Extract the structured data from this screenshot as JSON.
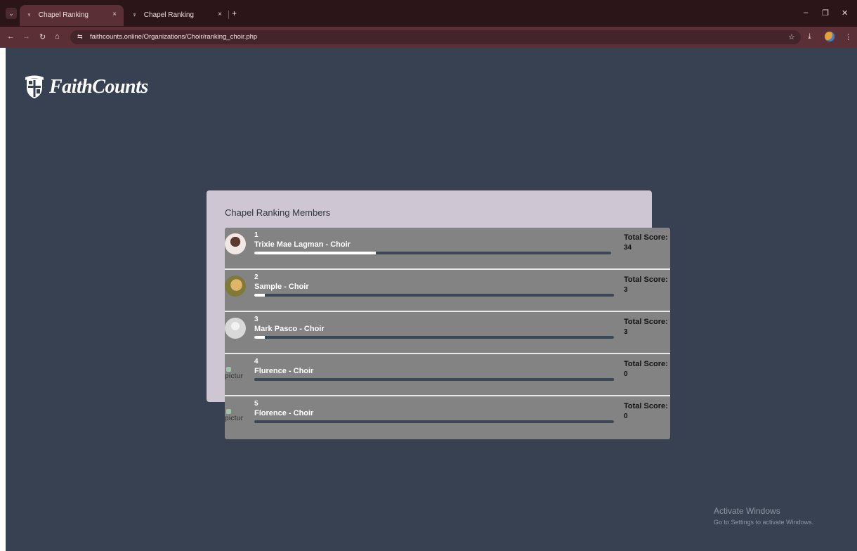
{
  "browser": {
    "tabs": [
      {
        "title": "Chapel Ranking",
        "active": true
      },
      {
        "title": "Chapel Ranking",
        "active": false
      }
    ],
    "new_tab_label": "+",
    "close_glyph": "×",
    "url": "faithcounts.online/Organizations/Choir/ranking_choir.php",
    "controls": {
      "minimize": "–",
      "maximize": "❐",
      "close": "✕"
    },
    "icons": {
      "back": "←",
      "forward": "→",
      "reload": "↻",
      "home": "⌂",
      "site_info": "⇆",
      "bookmark": "☆",
      "download": "⤓",
      "menu": "⋮",
      "tab_menu": "⌄"
    }
  },
  "brand": {
    "name": "FaithCounts"
  },
  "panel": {
    "title": "Chapel Ranking Members"
  },
  "members": [
    {
      "rank": "1",
      "name": "Trixie Mae Lagman - Choir",
      "score_label": "Total Score:",
      "score": "34",
      "progress_pct": 34,
      "avatar": "photo"
    },
    {
      "rank": "2",
      "name": "Sample - Choir",
      "score_label": "Total Score:",
      "score": "3",
      "progress_pct": 3,
      "avatar": "photo"
    },
    {
      "rank": "3",
      "name": "Mark Pasco - Choir",
      "score_label": "Total Score:",
      "score": "3",
      "progress_pct": 3,
      "avatar": "default"
    },
    {
      "rank": "4",
      "name": "Flurence - Choir",
      "score_label": "Total Score:",
      "score": "0",
      "progress_pct": 0,
      "avatar": "broken",
      "avatar_alt": "pictur"
    },
    {
      "rank": "5",
      "name": "Florence - Choir",
      "score_label": "Total Score:",
      "score": "0",
      "progress_pct": 0,
      "avatar": "broken",
      "avatar_alt": "pictur"
    }
  ],
  "watermark": {
    "line1": "Activate Windows",
    "line2": "Go to Settings to activate Windows."
  },
  "colors": {
    "page_bg": "#374151",
    "panel_bg": "#cfc6d3",
    "list_bg": "#838383",
    "bar_track": "#3b4656",
    "bar_fill": "#ffffff",
    "chrome": "#5a2f35"
  }
}
